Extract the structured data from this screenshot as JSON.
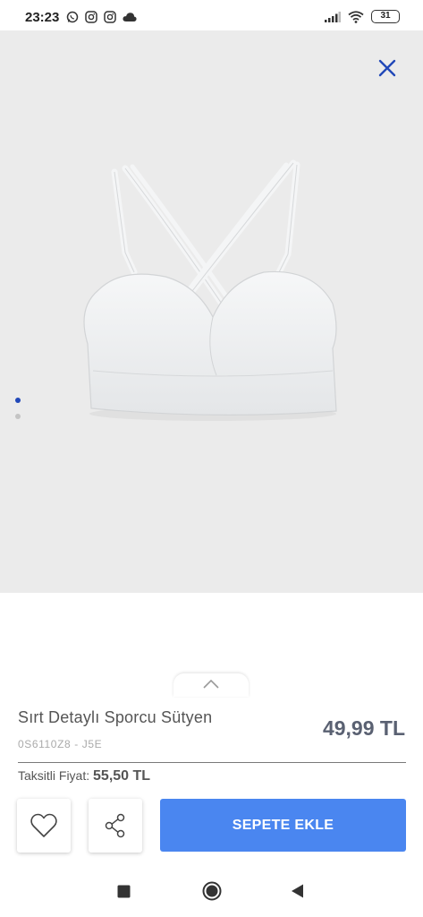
{
  "status_bar": {
    "time": "23:23",
    "battery": "31",
    "icons_left": [
      "whatsapp-icon",
      "instagram-icon",
      "instagram-icon",
      "cloud-icon"
    ],
    "icons_right": [
      "signal-icon",
      "wifi-icon",
      "battery-icon"
    ]
  },
  "gallery": {
    "image_count": 2,
    "active_index": 0,
    "background": "#ebebeb",
    "close_icon": "close-icon",
    "accent_color": "#2148b8"
  },
  "product": {
    "name": "Sırt Detaylı Sporcu Sütyen",
    "code": "0S6110Z8 - J5E",
    "price": "49,99 TL",
    "installment_label": "Taksitli Fiyat:",
    "installment_value": "55,50 TL"
  },
  "actions": {
    "favorite_icon": "heart-icon",
    "share_icon": "share-icon",
    "add_to_cart_label": "SEPETE EKLE",
    "add_to_cart_color": "#4a86f0"
  },
  "nav_bar": {
    "buttons": [
      "recent-apps-icon",
      "home-icon",
      "back-icon"
    ]
  }
}
